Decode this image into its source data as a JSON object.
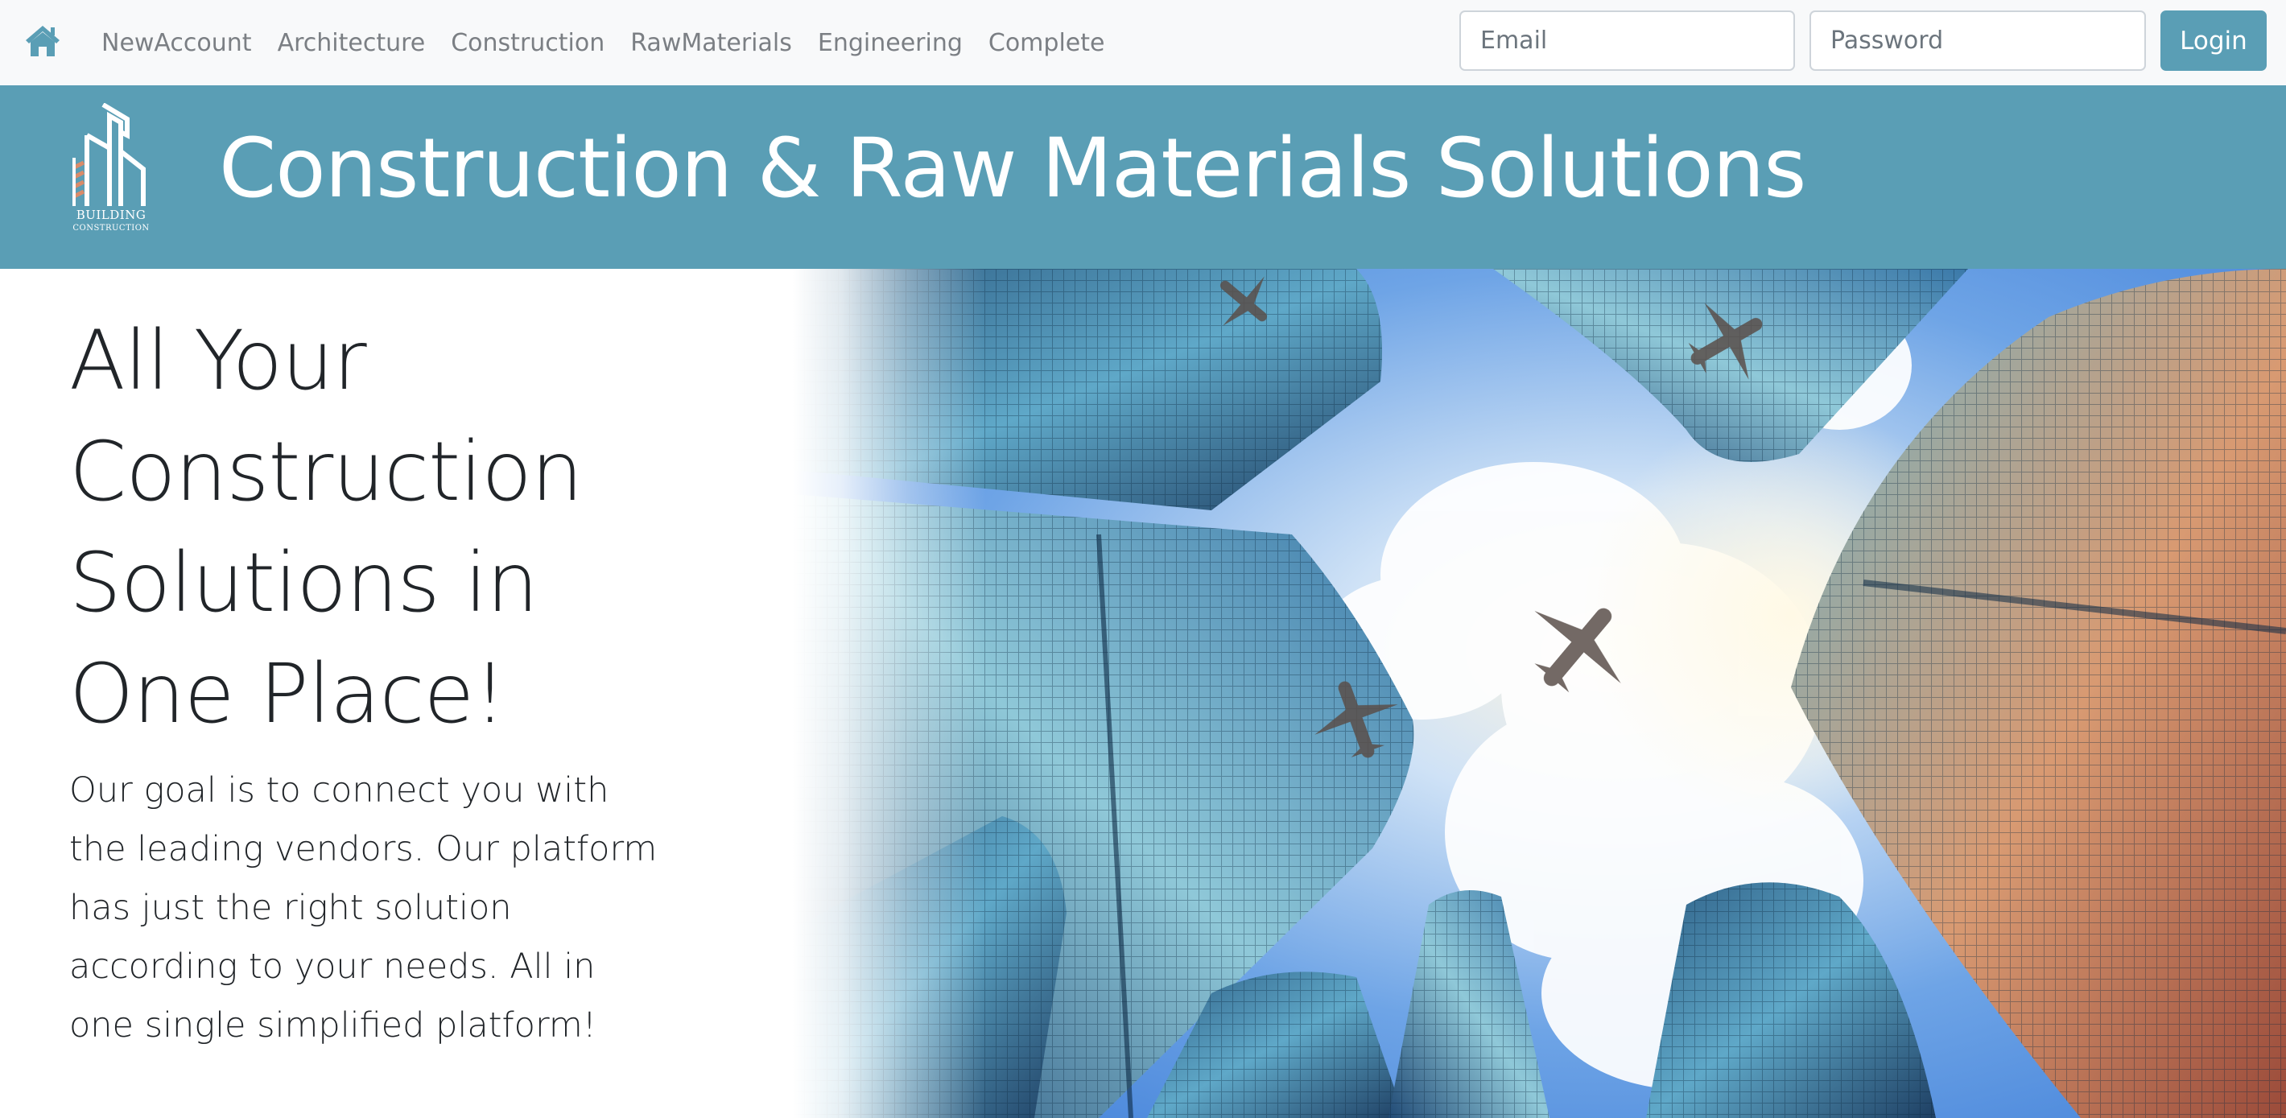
{
  "navbar": {
    "home_icon": "home-icon",
    "links": [
      "NewAccount",
      "Architecture",
      "Construction",
      "RawMaterials",
      "Engineering",
      "Complete"
    ],
    "email_placeholder": "Email",
    "password_placeholder": "Password",
    "login_label": "Login"
  },
  "banner": {
    "logo_line1": "BUILDING",
    "logo_line2": "CONSTRUCTION",
    "title": "Construction & Raw Materials Solutions"
  },
  "hero": {
    "heading": "All Your Construction Solutions in One Place!",
    "body": "Our goal is to connect you with the leading vendors. Our platform has just the right solution according to your needs. All in one single simplified platform!"
  },
  "colors": {
    "brand": "#5a9eb5",
    "navbar_bg": "#f8f9fa",
    "nav_text": "#7b7f84",
    "heading_text": "#212529"
  }
}
